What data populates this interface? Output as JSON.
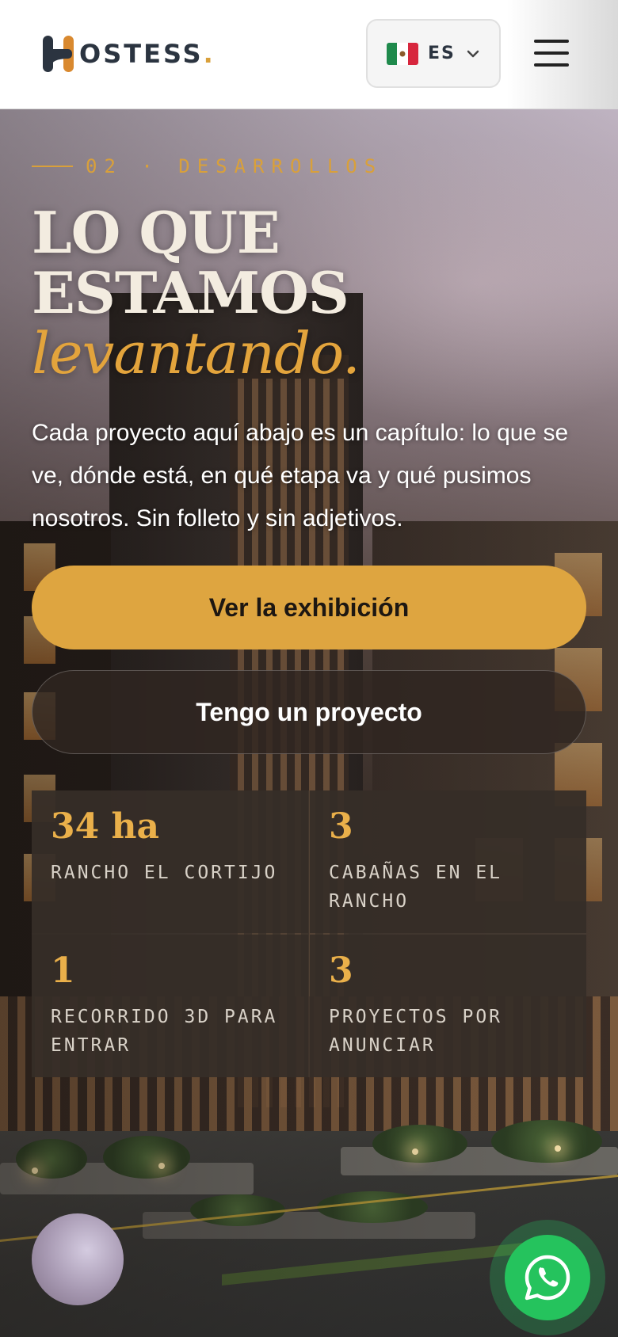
{
  "header": {
    "logo_text": "OSTESS",
    "logo_dot": ".",
    "lang_code": "ES",
    "lang_flag": "mexico-flag-icon",
    "menu_icon": "hamburger-menu-icon"
  },
  "hero": {
    "eyebrow": "02 · DESARROLLOS",
    "title_line1": "LO QUE",
    "title_line2": "ESTAMOS",
    "title_accent": "levantando.",
    "description": "Cada proyecto aquí abajo es un capítulo: lo que se ve, dónde está, en qué etapa va y qué pusimos nosotros. Sin folleto y sin adjetivos.",
    "primary_button": "Ver la exhibición",
    "secondary_button": "Tengo un proyecto",
    "stats": [
      {
        "value": "34 ha",
        "label": "RANCHO EL CORTIJO"
      },
      {
        "value": "3",
        "label": "CABAÑAS EN EL RANCHO"
      },
      {
        "value": "1",
        "label": "RECORRIDO 3D PARA ENTRAR"
      },
      {
        "value": "3",
        "label": "PROYECTOS POR ANUNCIAR"
      }
    ]
  },
  "floating": {
    "whatsapp_icon": "whatsapp-icon"
  },
  "colors": {
    "accent": "#dea540",
    "brand_dark": "#2b3440",
    "whatsapp": "#25c35d"
  }
}
